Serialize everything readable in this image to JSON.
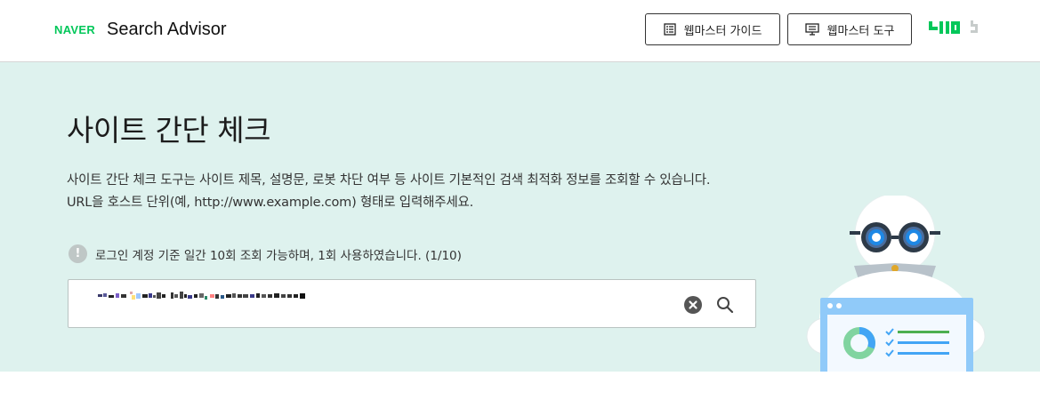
{
  "header": {
    "logo": "NAVER",
    "app_name": "Search Advisor",
    "buttons": {
      "guide": "웹마스터 가이드",
      "tools": "웹마스터 도구"
    },
    "icons": {
      "guide": "document-list-icon",
      "tools": "monitor-icon"
    }
  },
  "main": {
    "title": "사이트 간단 체크",
    "description_line1": "사이트 간단 체크 도구는 사이트 제목, 설명문, 로봇 차단 여부 등 사이트 기본적인 검색 최적화 정보를 조회할 수 있습니다.",
    "description_line2": "URL을 호스트 단위(예, http://www.example.com) 형태로 입력해주세요.",
    "notice": "로그인 계정 기준 일간 10회 조회 가능하며, 1회 사용하였습니다. (1/10)",
    "notice_icon": "!",
    "search": {
      "value": "",
      "clear_icon": "close-circle-icon",
      "search_icon": "search-icon"
    }
  },
  "colors": {
    "brand": "#03c75a",
    "hero_bg": "#def2ee",
    "robot_eye": "#1e88e5"
  }
}
